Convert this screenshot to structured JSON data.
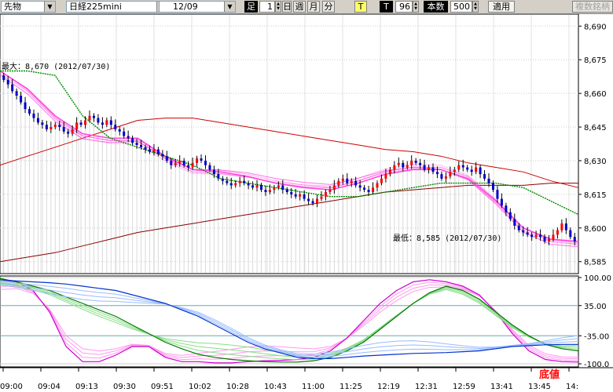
{
  "toolbar": {
    "instrument": "先物",
    "symbol": "日経225mini",
    "date": "12/09",
    "period_label": "足",
    "period_value": "1",
    "unit_day": "日",
    "unit_week": "週",
    "unit_month": "月",
    "unit_minute": "分",
    "tick_t_button": "T",
    "tick_t_label": "T",
    "tick_count": "96",
    "bar_count_label": "本数",
    "bar_count": "500",
    "apply_button": "適用",
    "multi_symbol_button": "複数銘柄"
  },
  "colors": {
    "up_candle": "#ff0000",
    "down_candle": "#0000cc",
    "ma_short": "#ff44dd",
    "ma_mid": "#008800",
    "ma_long": "#cc0000",
    "osc_fast": "#cc00cc",
    "osc_slow": "#0033cc",
    "osc_green": "#007700",
    "volume_bar": "#bbbbbb"
  },
  "chart_data": [
    {
      "type": "candlestick",
      "price_axis": {
        "range": [
          8580,
          8695
        ],
        "ticks": [
          "8,690",
          "8,675",
          "8,660",
          "8,645",
          "8,630",
          "8,615",
          "8,600",
          "8,585"
        ]
      },
      "time_labels": [
        "09:00",
        "09:04",
        "09:13",
        "09:30",
        "09:51",
        "10:02",
        "10:28",
        "10:43",
        "11:00",
        "11:25",
        "12:19",
        "12:31",
        "12:59",
        "13:41",
        "13:45",
        "14:"
      ],
      "annotations": {
        "high": "最大：8,670 (2012/07/30)",
        "low": "最低：8,585 (2012/07/30)"
      },
      "close": [
        8666,
        8664,
        8661,
        8659,
        8656,
        8653,
        8651,
        8649,
        8647,
        8646,
        8644,
        8645,
        8646,
        8645,
        8643,
        8642,
        8644,
        8647,
        8646,
        8648,
        8650,
        8649,
        8647,
        8646,
        8648,
        8646,
        8644,
        8643,
        8641,
        8640,
        8638,
        8637,
        8636,
        8635,
        8634,
        8635,
        8633,
        8632,
        8630,
        8628,
        8629,
        8630,
        8628,
        8627,
        8629,
        8631,
        8630,
        8628,
        8626,
        8624,
        8622,
        8621,
        8620,
        8619,
        8620,
        8621,
        8620,
        8619,
        8618,
        8619,
        8617,
        8616,
        8617,
        8618,
        8619,
        8617,
        8616,
        8615,
        8614,
        8615,
        8613,
        8612,
        8611,
        8613,
        8614,
        8616,
        8617,
        8619,
        8621,
        8622,
        8620,
        8621,
        8619,
        8618,
        8617,
        8616,
        8618,
        8620,
        8622,
        8624,
        8626,
        8628,
        8629,
        8627,
        8628,
        8630,
        8629,
        8628,
        8626,
        8627,
        8625,
        8624,
        8622,
        8623,
        8625,
        8626,
        8628,
        8627,
        8626,
        8625,
        8627,
        8624,
        8622,
        8620,
        8617,
        8613,
        8610,
        8607,
        8604,
        8601,
        8599,
        8598,
        8597,
        8596,
        8597,
        8596,
        8594,
        8595,
        8597,
        8599,
        8602,
        8599,
        8596,
        8594
      ],
      "ma_short_values": [
        8670,
        8662,
        8650,
        8642,
        8640,
        8640,
        8632,
        8626,
        8625,
        8623,
        8620,
        8618,
        8617,
        8620,
        8624,
        8626,
        8626,
        8622,
        8612,
        8600,
        8595,
        8594
      ],
      "ma_mid_values": [
        8670,
        8670,
        8668,
        8650,
        8640,
        8636,
        8632,
        8628,
        8622,
        8620,
        8618,
        8616,
        8614,
        8614,
        8616,
        8618,
        8620,
        8620,
        8620,
        8618,
        8612,
        8606
      ],
      "ma_long_values": [
        8628,
        8632,
        8636,
        8640,
        8644,
        8648,
        8649,
        8649,
        8647,
        8645,
        8643,
        8641,
        8639,
        8637,
        8635,
        8634,
        8632,
        8629,
        8627,
        8625,
        8621,
        8618
      ],
      "ma_longest_values": [
        8585,
        8587,
        8589,
        8592,
        8595,
        8598,
        8600,
        8602,
        8604,
        8606,
        8608,
        8610,
        8612,
        8614,
        8616,
        8617,
        8618,
        8619,
        8619,
        8619,
        8620,
        8620
      ]
    },
    {
      "type": "line",
      "title": "oscillator",
      "y_axis": {
        "range": [
          -100,
          100
        ],
        "ticks": [
          "100.00",
          "35.00",
          "-35.00",
          "-100.0"
        ]
      },
      "badge": "底値",
      "series": [
        {
          "values": [
            95,
            90,
            70,
            20,
            -60,
            -95,
            -95,
            -80,
            -60,
            -60,
            -85,
            -95,
            -95,
            -98,
            -98,
            -95,
            -93,
            -92,
            -90,
            -85,
            -70,
            -40,
            0,
            40,
            70,
            90,
            95,
            90,
            80,
            60,
            20,
            -30,
            -70,
            -90,
            -95,
            -96
          ]
        },
        {
          "values": [
            98,
            90,
            80,
            70,
            55,
            40,
            25,
            10,
            -10,
            -30,
            -50,
            -65,
            -78,
            -85,
            -90,
            -93,
            -95,
            -96,
            -96,
            -93,
            -85,
            -70,
            -50,
            -20,
            10,
            40,
            65,
            80,
            70,
            50,
            20,
            -10,
            -35,
            -55,
            -65,
            -70
          ]
        },
        {
          "values": [
            95,
            92,
            90,
            88,
            85,
            80,
            75,
            70,
            60,
            50,
            40,
            25,
            10,
            -10,
            -30,
            -50,
            -65,
            -75,
            -85,
            -88,
            -88,
            -85,
            -82,
            -80,
            -78,
            -76,
            -75,
            -74,
            -72,
            -70,
            -65,
            -60,
            -58,
            -56,
            -55,
            -55
          ]
        }
      ]
    }
  ]
}
